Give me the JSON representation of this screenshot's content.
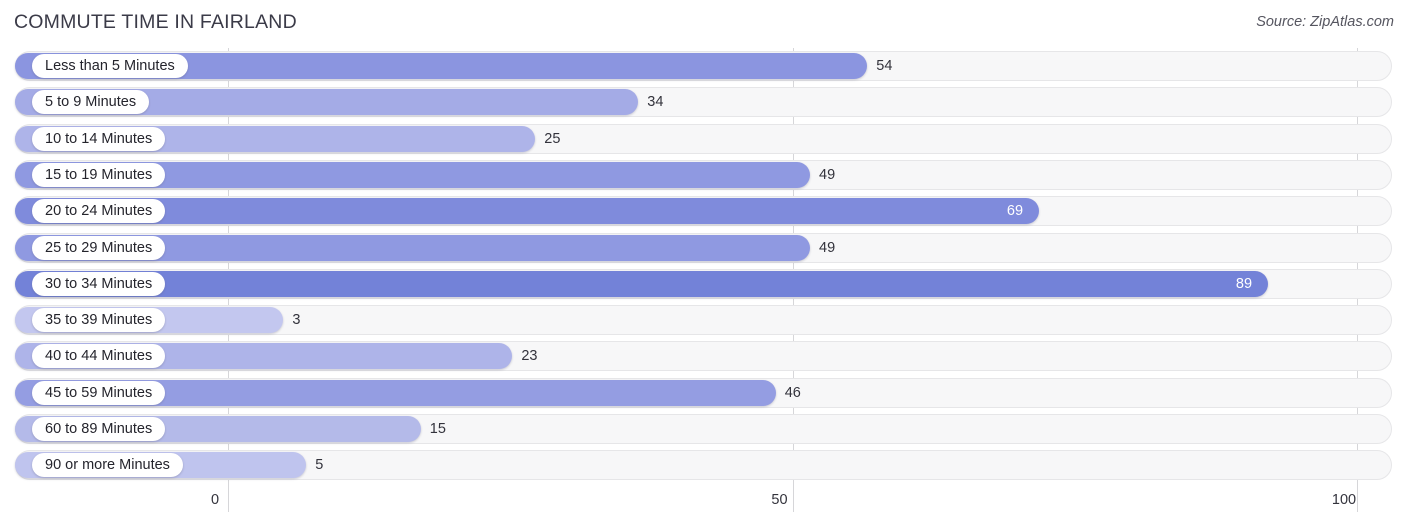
{
  "header": {
    "title": "COMMUTE TIME IN FAIRLAND",
    "source": "Source: ZipAtlas.com"
  },
  "chart_data": {
    "type": "bar",
    "orientation": "horizontal",
    "title": "COMMUTE TIME IN FAIRLAND",
    "xlabel": "",
    "ylabel": "",
    "xlim": [
      0,
      100
    ],
    "xticks": [
      0,
      50,
      100
    ],
    "xtick_labels": [
      "0",
      "50",
      "100"
    ],
    "grid": true,
    "legend": false,
    "categories": [
      "Less than 5 Minutes",
      "5 to 9 Minutes",
      "10 to 14 Minutes",
      "15 to 19 Minutes",
      "20 to 24 Minutes",
      "25 to 29 Minutes",
      "30 to 34 Minutes",
      "35 to 39 Minutes",
      "40 to 44 Minutes",
      "45 to 59 Minutes",
      "60 to 89 Minutes",
      "90 or more Minutes"
    ],
    "values": [
      54,
      34,
      25,
      49,
      69,
      49,
      89,
      3,
      23,
      46,
      15,
      5
    ],
    "value_labels": [
      "54",
      "34",
      "25",
      "49",
      "69",
      "49",
      "89",
      "3",
      "23",
      "46",
      "15",
      "5"
    ],
    "label_placement": [
      "outside",
      "outside",
      "outside",
      "outside",
      "inside",
      "outside",
      "inside",
      "outside",
      "outside",
      "outside",
      "outside",
      "outside"
    ],
    "bar_colors": [
      "#8b95e0",
      "#a4abe6",
      "#aeb4e9",
      "#8f99e1",
      "#7f8bdc",
      "#8f99e1",
      "#7382d8",
      "#c3c7ef",
      "#aeb4e9",
      "#949de2",
      "#b4bae9",
      "#bfc4ee"
    ],
    "track_color": "#f7f7f8",
    "gridline_color": "#d6d6d9",
    "accent_color": "#8b95e0"
  }
}
